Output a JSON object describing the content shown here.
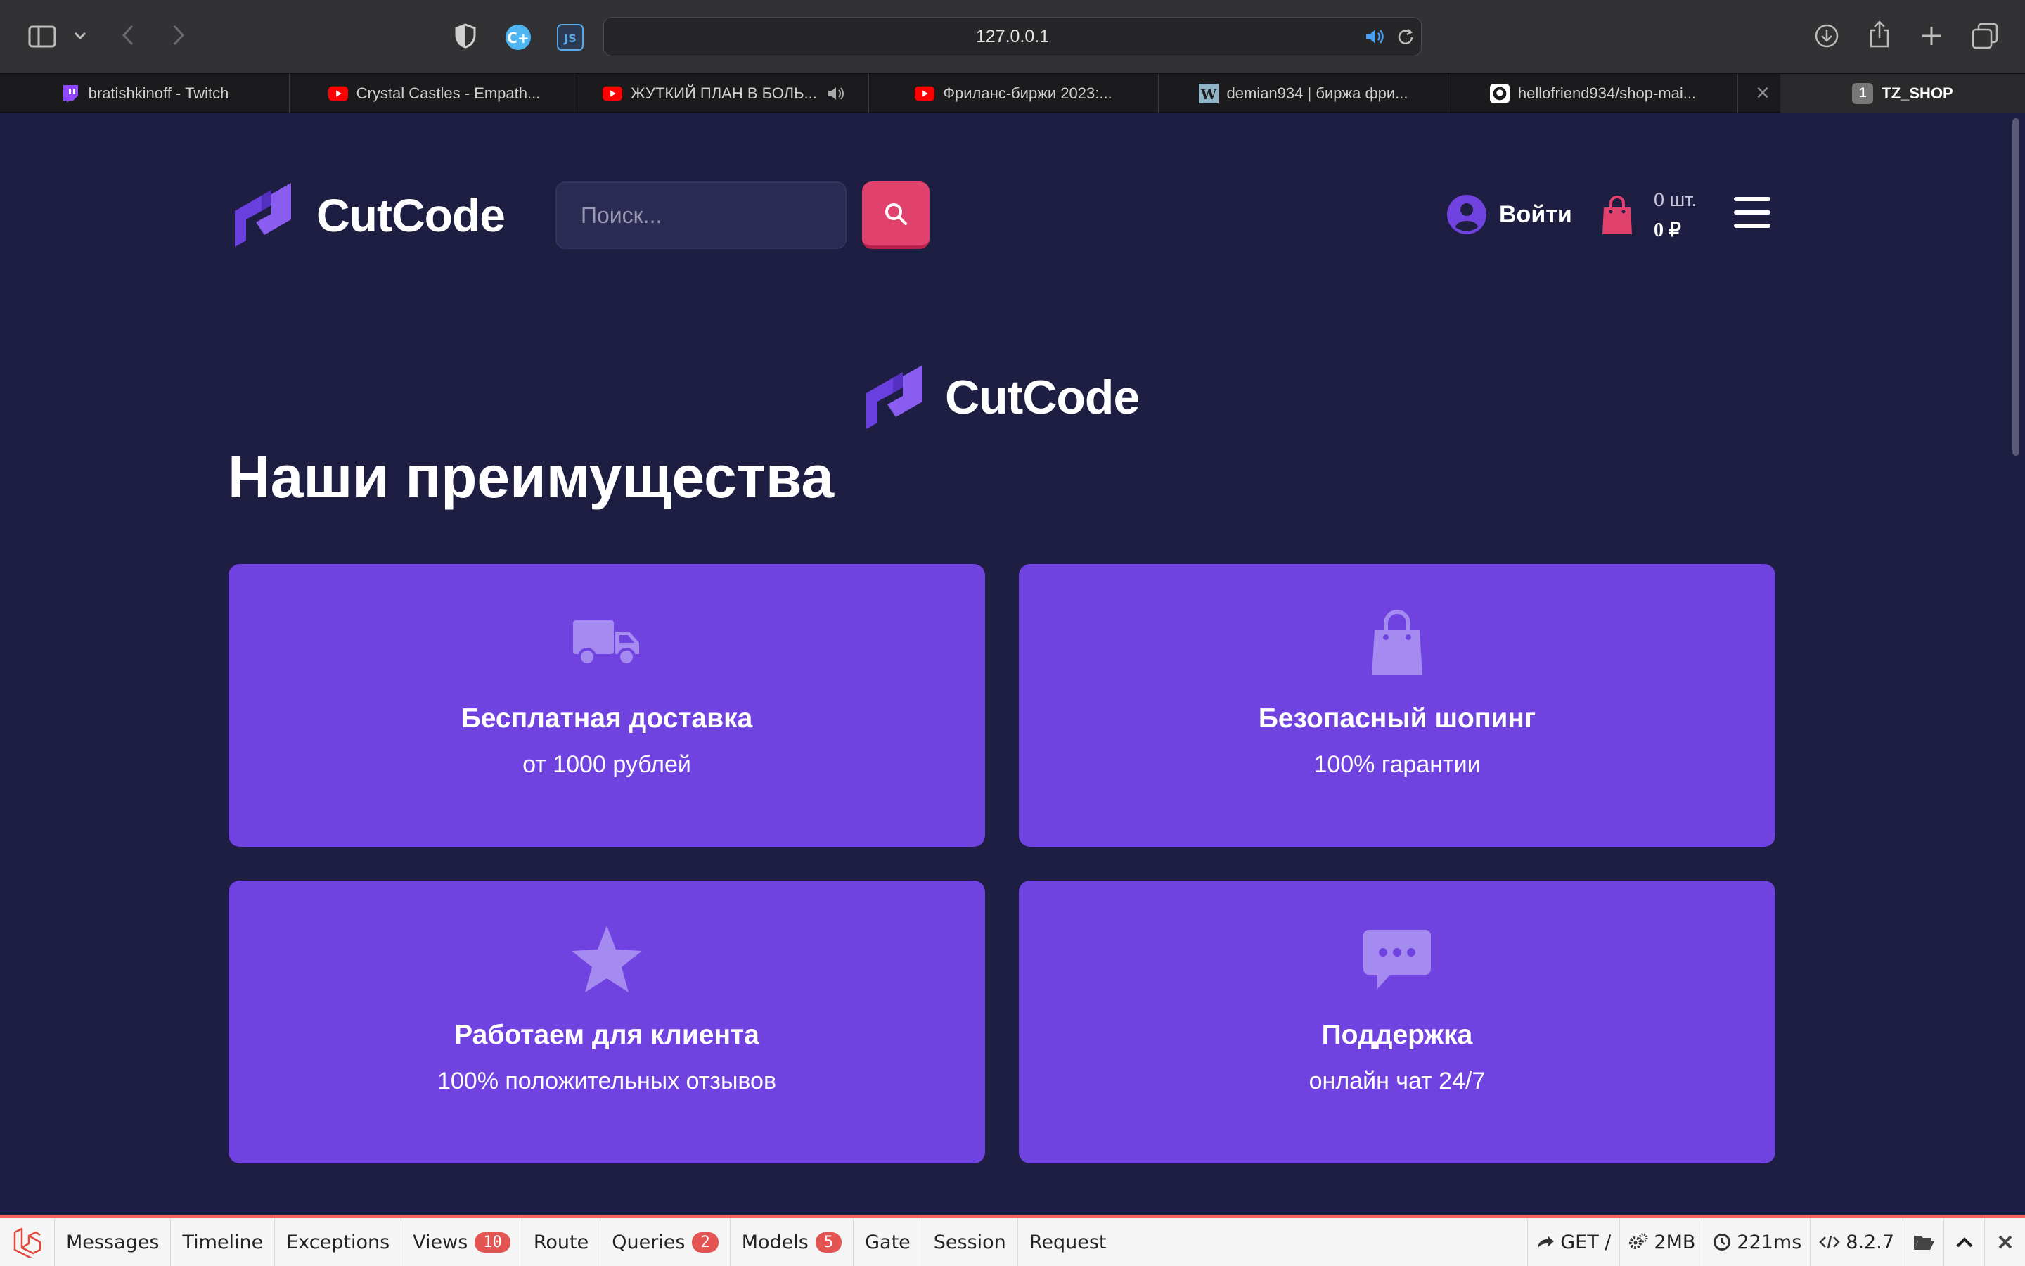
{
  "browser": {
    "url": "127.0.0.1",
    "tabs": [
      {
        "label": "bratishkinoff - Twitch",
        "icon": "twitch-icon"
      },
      {
        "label": "Crystal Castles - Empath...",
        "icon": "youtube-icon"
      },
      {
        "label": "ЖУТКИЙ ПЛАН В БОЛЬ...",
        "icon": "youtube-icon"
      },
      {
        "label": "Фриланс-биржи 2023:...",
        "icon": "youtube-icon"
      },
      {
        "label": "demian934 | биржа фри...",
        "icon": "weblancer-icon"
      },
      {
        "label": "hellofriend934/shop-mai...",
        "icon": "github-icon"
      },
      {
        "label": "TZ_SHOP",
        "badge": "1"
      }
    ]
  },
  "header": {
    "logo_text": "CutCode",
    "search_placeholder": "Поиск...",
    "login_label": "Войти",
    "cart_count": "0 шт.",
    "cart_sum": "0 ₽"
  },
  "main": {
    "logo_text": "CutCode",
    "heading": "Наши преимущества",
    "cards": [
      {
        "title": "Бесплатная доставка",
        "subtitle": "от 1000 рублей",
        "icon": "truck-icon"
      },
      {
        "title": "Безопасный шопинг",
        "subtitle": "100% гарантии",
        "icon": "shopping-bag-icon"
      },
      {
        "title": "Работаем для клиента",
        "subtitle": "100% положительных отзывов",
        "icon": "star-icon"
      },
      {
        "title": "Поддержка",
        "subtitle": "онлайн чат 24/7",
        "icon": "chat-icon"
      }
    ]
  },
  "debugbar": {
    "items": [
      {
        "label": "Messages"
      },
      {
        "label": "Timeline"
      },
      {
        "label": "Exceptions"
      },
      {
        "label": "Views",
        "badge": "10"
      },
      {
        "label": "Route"
      },
      {
        "label": "Queries",
        "badge": "2"
      },
      {
        "label": "Models",
        "badge": "5"
      },
      {
        "label": "Gate"
      },
      {
        "label": "Session"
      },
      {
        "label": "Request"
      }
    ],
    "method": "GET /",
    "memory": "2MB",
    "time": "221ms",
    "php_version": "8.2.7"
  },
  "colors": {
    "page_bg": "#1e1e42",
    "card_bg": "#7043e0",
    "accent_pink": "#e0426d",
    "logo_purple": "#6a3fe0"
  }
}
